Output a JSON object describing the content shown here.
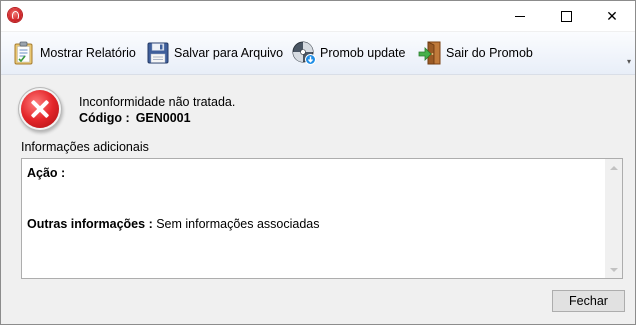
{
  "window": {
    "title": ""
  },
  "titlebar": {
    "app_icon": "promob-logo-icon",
    "minimize_icon": "minimize-icon",
    "maximize_icon": "maximize-icon",
    "close_icon": "close-icon",
    "close_glyph": "✕"
  },
  "toolbar": {
    "items": [
      {
        "label": "Mostrar Relatório",
        "icon": "report-clipboard-icon"
      },
      {
        "label": "Salvar para Arquivo",
        "icon": "floppy-disk-icon"
      },
      {
        "label": "Promob update",
        "icon": "update-globe-icon"
      },
      {
        "label": "Sair do Promob",
        "icon": "exit-door-icon"
      }
    ],
    "overflow_glyph": "▾",
    "overflow_icon": "toolbar-overflow-icon"
  },
  "message": {
    "icon": "error-icon",
    "text": "Inconformidade não tratada.",
    "code_label": "Código :",
    "code_value": "GEN0001"
  },
  "details": {
    "label": "Informações adicionais",
    "action_label": "Ação :",
    "other_label": "Outras informações :",
    "other_value": " Sem informações associadas"
  },
  "footer": {
    "close_label": "Fechar"
  },
  "colors": {
    "error_red": "#e4262a",
    "toolbar_gradient_top": "#fbfcfe",
    "toolbar_gradient_bottom": "#e8eef8",
    "window_bg": "#f0f0f0"
  }
}
